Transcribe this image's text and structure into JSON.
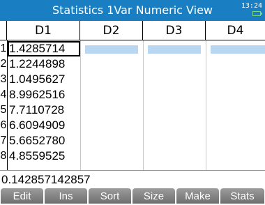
{
  "app": {
    "title": "Statistics 1Var Numeric View",
    "clock": "13:24"
  },
  "table": {
    "columns": [
      "D1",
      "D2",
      "D3",
      "D4"
    ],
    "row_numbers": [
      "1",
      "2",
      "3",
      "4",
      "5",
      "6",
      "7",
      "8"
    ],
    "d1_values": [
      "1.4285714",
      "1.2244898",
      "1.0495627",
      "8.9962516",
      "7.7110728",
      "6.6094909",
      "5.6652780",
      "4.8559525"
    ]
  },
  "entry_line": {
    "value": "0.142857142857"
  },
  "menu": [
    "Edit",
    "Ins",
    "Sort",
    "Size",
    "Make",
    "Stats"
  ]
}
